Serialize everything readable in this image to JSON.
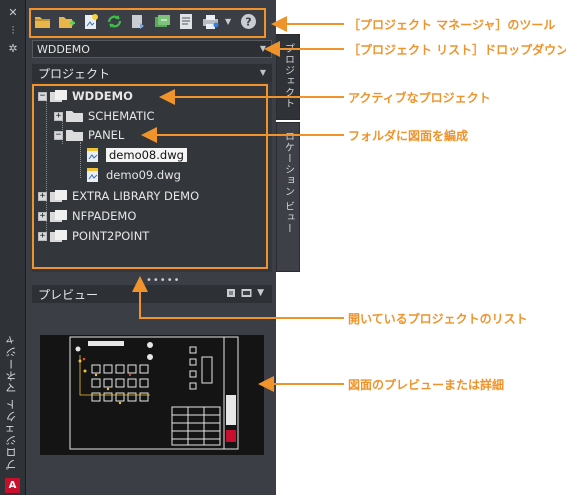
{
  "left_bar": {
    "title": "プロジェクト マネージャ",
    "close_glyph": "✕",
    "pin_glyph": "⫶",
    "settings_glyph": "✲",
    "logo_text": "A"
  },
  "toolbar": {
    "icons": [
      "open-project-icon",
      "new-project-icon",
      "new-drawing-icon",
      "refresh-icon",
      "publish-icon",
      "copy-project-icon",
      "project-properties-icon",
      "print-icon",
      "help-icon"
    ],
    "dropdown_glyph": "▼",
    "help_glyph": "?"
  },
  "project_list": {
    "selected": "WDDEMO",
    "chevron": "▼"
  },
  "projects_section": {
    "header": "プロジェクト",
    "chevron": "▼"
  },
  "tree": {
    "active_project": "WDDEMO",
    "folder_schematic": "SCHEMATIC",
    "folder_panel": "PANEL",
    "drawing_1": "demo08.dwg",
    "drawing_2": "demo09.dwg",
    "project_2": "EXTRA LIBRARY DEMO",
    "project_3": "NFPADEMO",
    "project_4": "POINT2POINT",
    "expand_glyph": "+",
    "collapse_glyph": "−"
  },
  "grip": "•••••",
  "preview_section": {
    "header": "プレビュー",
    "chevron": "▼"
  },
  "vertical_tabs": {
    "project": "プロジェクト",
    "location": "ロケーション ビュー"
  },
  "callouts": {
    "toolbar": "［プロジェクト マネージャ］のツール",
    "project_list": "［プロジェクト リスト］ドロップダウン",
    "active_project": "アクティブなプロジェクト",
    "folder": "フォルダに図面を編成",
    "open_projects": "開いているプロジェクトのリスト",
    "preview": "図面のプレビューまたは詳細"
  },
  "colors": {
    "accent_orange": "#f0932b",
    "panel_bg": "#3b3f45",
    "tree_bg": "#33363b",
    "header_bg": "#2d3035"
  }
}
